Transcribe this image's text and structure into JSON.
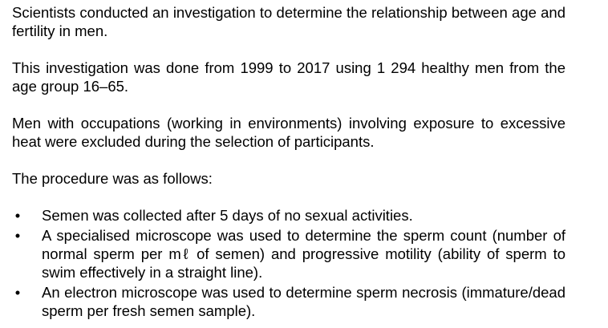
{
  "paragraphs": [
    "Scientists conducted an investigation to determine the relationship between age and fertility in men.",
    "This investigation was done from 1999 to 2017 using 1 294 healthy men from the age group 16–65.",
    "Men with occupations (working in environments) involving exposure to excessive heat were excluded during the selection of participants.",
    "The procedure was as follows:"
  ],
  "bullet_symbol": "•",
  "bullets": [
    "Semen was collected after 5 days of no sexual activities.",
    "A specialised microscope was used to determine the sperm count (number of normal sperm per mℓ of semen) and progressive motility (ability of sperm to swim effectively in a straight line).",
    "An electron microscope was used to determine sperm necrosis (immature/dead sperm per fresh semen sample)."
  ]
}
